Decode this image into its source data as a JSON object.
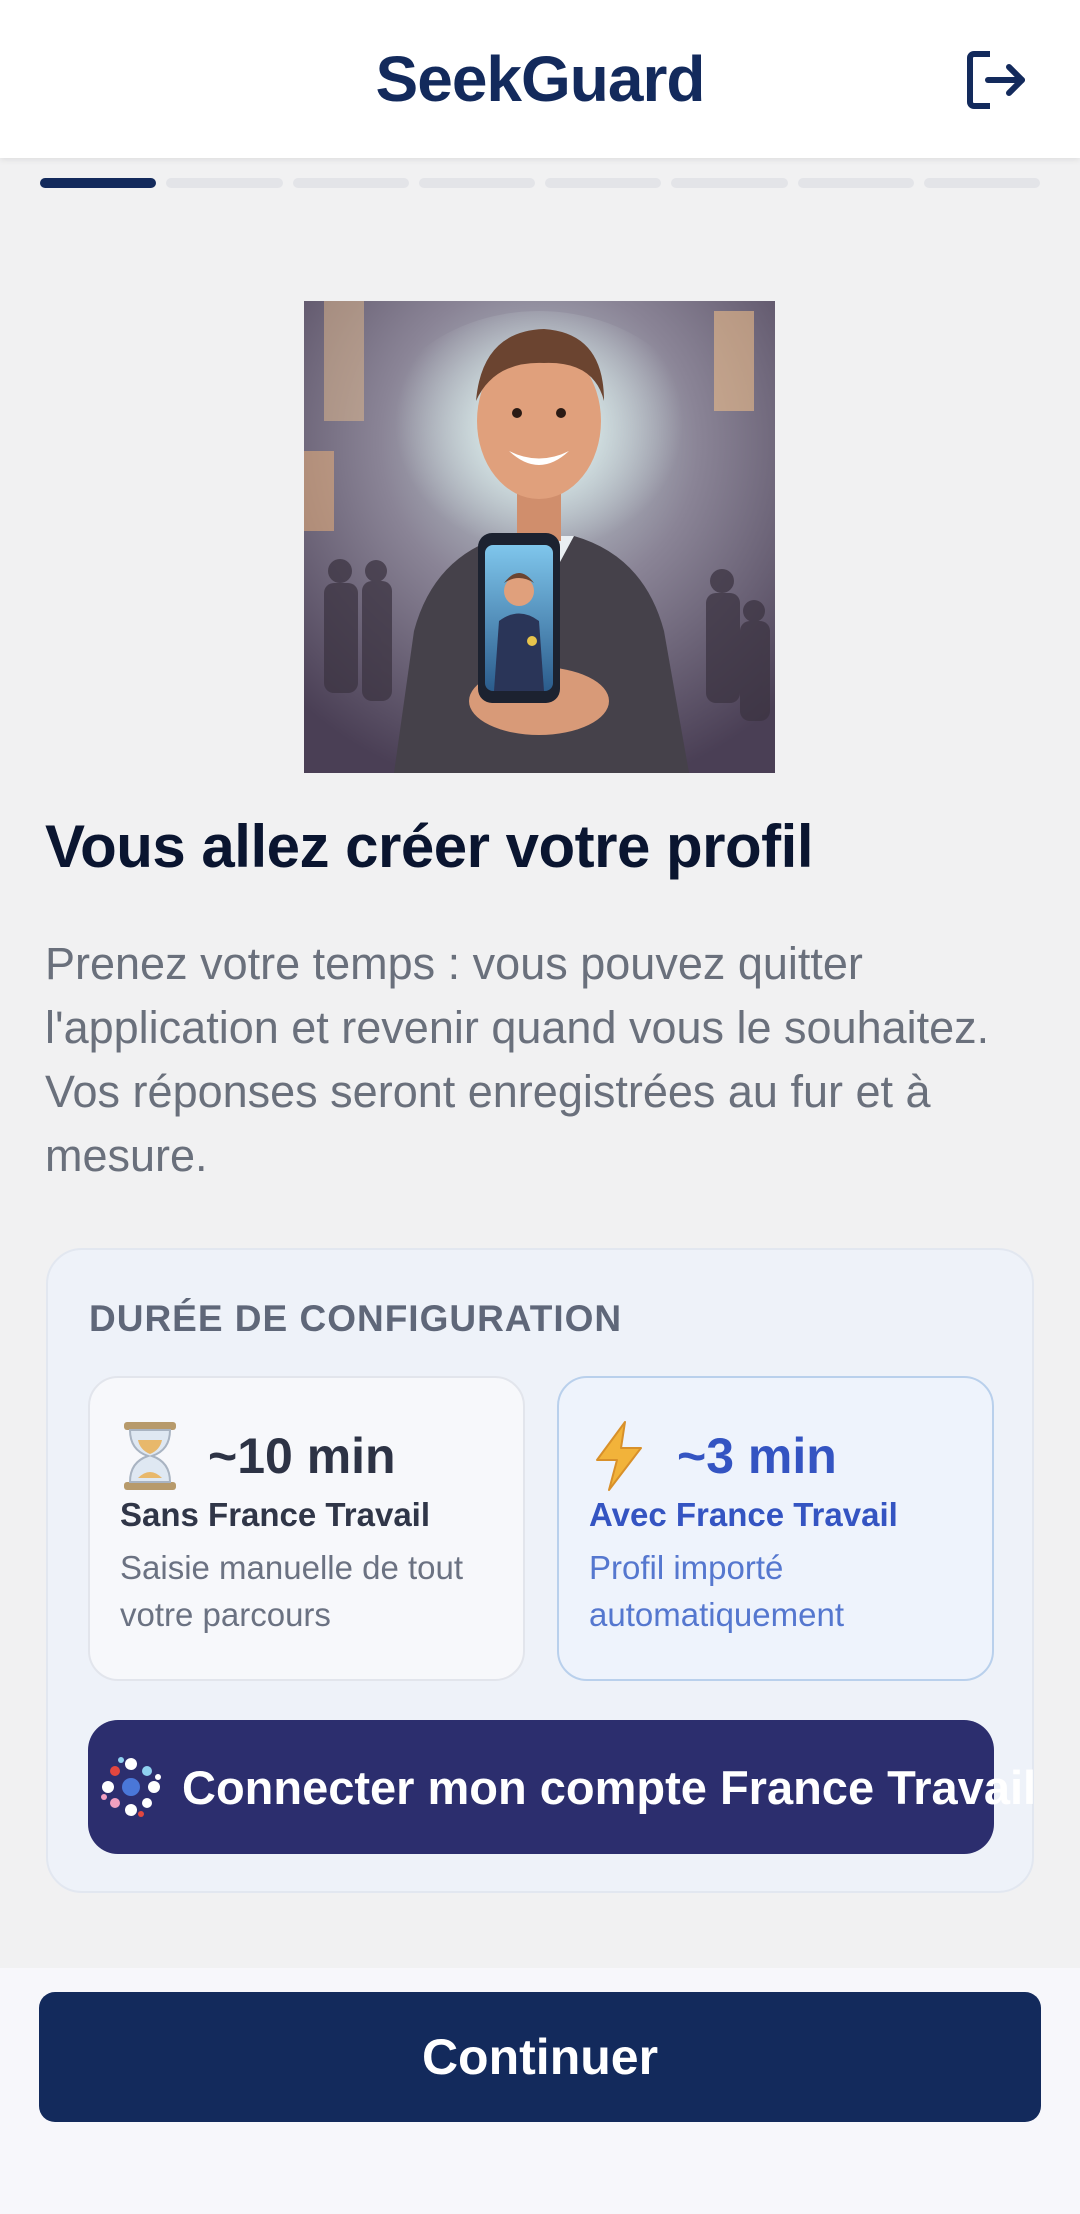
{
  "header": {
    "brand": "SeekGuard",
    "logout_icon": "logout-icon"
  },
  "progress": {
    "total_steps": 8,
    "current_step": 1
  },
  "hero": {
    "illustration": "smiling-man-holding-phone-illustration"
  },
  "title": "Vous allez créer votre profil",
  "description": "Prenez votre temps : vous pouvez quitter l'application et revenir quand vous le souhaitez. Vos réponses seront enregistrées au fur et à mesure.",
  "config": {
    "label": "DURÉE DE CONFIGURATION",
    "options": [
      {
        "icon": "hourglass-icon",
        "duration": "~10 min",
        "title": "Sans France Travail",
        "note": "Saisie manuelle de tout votre parcours"
      },
      {
        "icon": "lightning-icon",
        "duration": "~3 min",
        "title": "Avec France Travail",
        "note": "Profil importé automatiquement"
      }
    ],
    "connect_button": {
      "icon": "france-travail-logo-icon",
      "label": "Connecter mon compte France Travail"
    }
  },
  "footer": {
    "continue_label": "Continuer"
  },
  "colors": {
    "primary_navy": "#132a5c",
    "france_travail_button": "#2c2e6e",
    "accent_blue": "#3454c2",
    "background": "#f1f1f2"
  }
}
